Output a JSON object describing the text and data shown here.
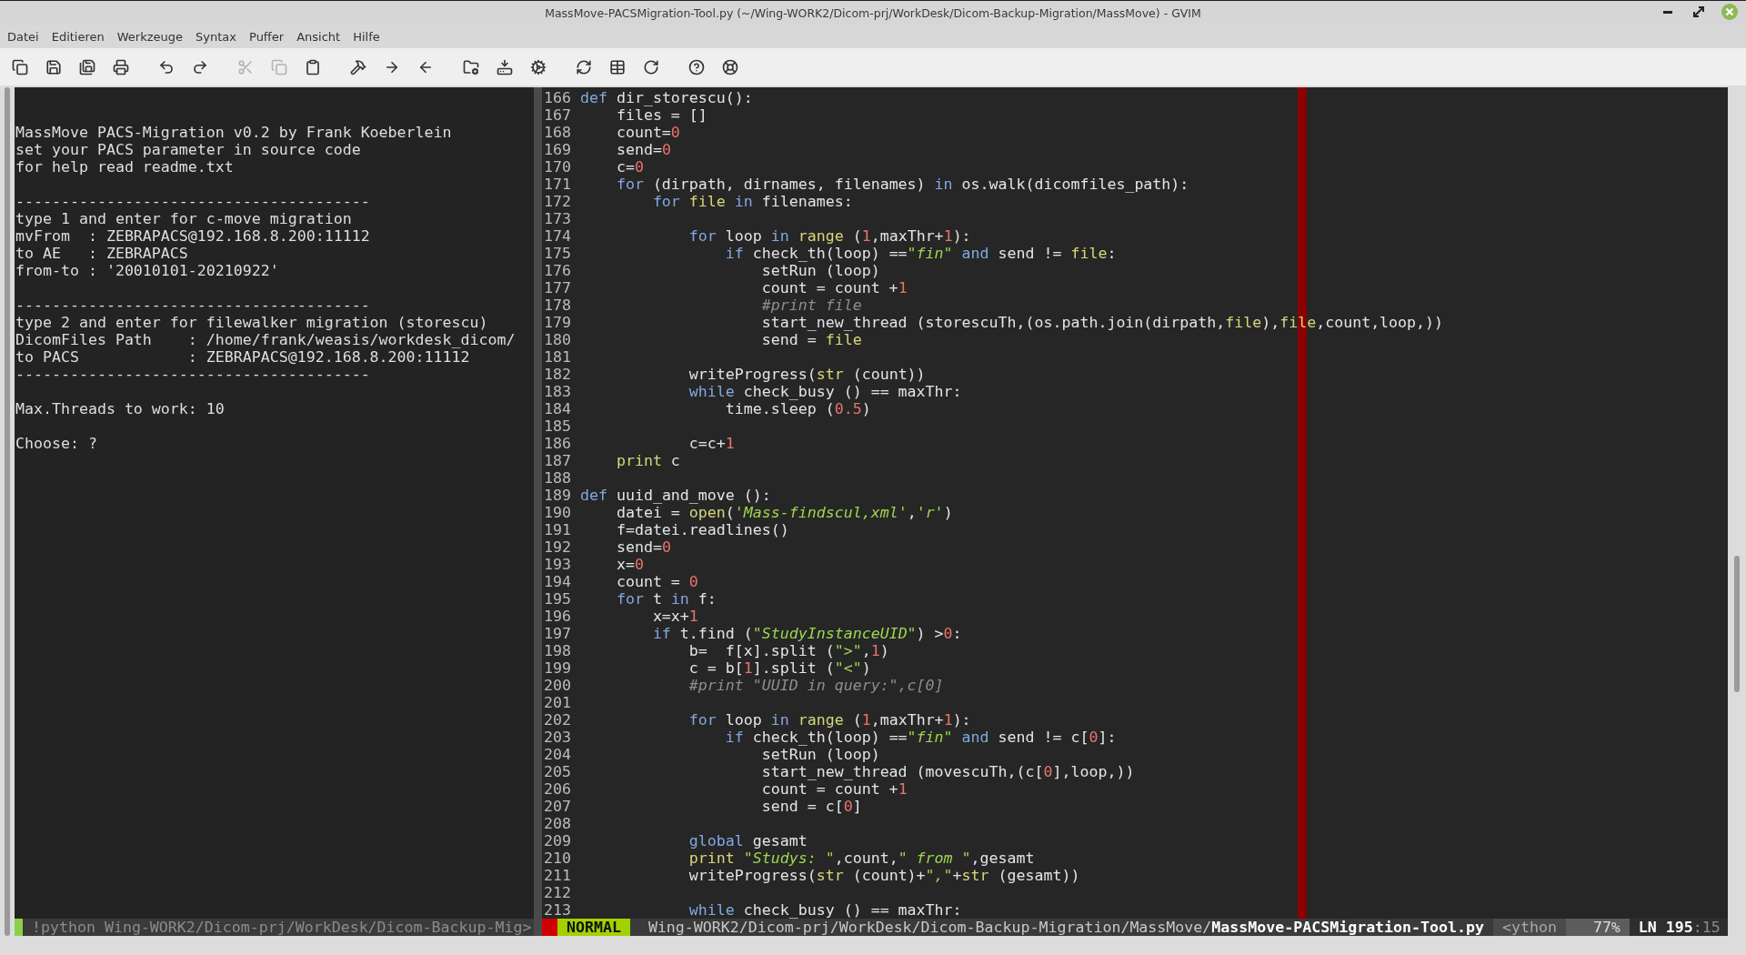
{
  "window": {
    "title": "MassMove-PACSMigration-Tool.py (~/Wing-WORK2/Dicom-prj/WorkDesk/Dicom-Backup-Migration/MassMove) - GVIM"
  },
  "menu": [
    "Datei",
    "Editieren",
    "Werkzeuge",
    "Syntax",
    "Puffer",
    "Ansicht",
    "Hilfe"
  ],
  "toolbar": {
    "groups": [
      [
        {
          "kind": "new-window",
          "disabled": false
        },
        {
          "kind": "save",
          "disabled": false
        },
        {
          "kind": "save-all",
          "disabled": false
        },
        {
          "kind": "print",
          "disabled": false
        }
      ],
      [
        {
          "kind": "undo",
          "disabled": false
        },
        {
          "kind": "redo",
          "disabled": false
        }
      ],
      [
        {
          "kind": "cut",
          "disabled": true
        },
        {
          "kind": "copy",
          "disabled": true
        },
        {
          "kind": "paste",
          "disabled": false
        }
      ],
      [
        {
          "kind": "replace",
          "disabled": false
        },
        {
          "kind": "find-next",
          "disabled": false
        },
        {
          "kind": "find-previous",
          "disabled": false
        }
      ],
      [
        {
          "kind": "load-session",
          "disabled": false
        },
        {
          "kind": "save-session",
          "disabled": false
        },
        {
          "kind": "run-script",
          "disabled": false
        }
      ],
      [
        {
          "kind": "make",
          "disabled": false
        },
        {
          "kind": "tags",
          "disabled": false
        },
        {
          "kind": "jump-tag",
          "disabled": false
        }
      ],
      [
        {
          "kind": "help",
          "disabled": false
        },
        {
          "kind": "find-help",
          "disabled": false
        }
      ]
    ]
  },
  "left_pane": {
    "groups": [
      [
        "MassMove PACS-Migration v0.2 by Frank Koeberlein",
        "set your PACS parameter in source code",
        "for help read readme.txt"
      ],
      [
        "---------------------------------------",
        "type 1 and enter for c-move migration",
        "mvFrom  : ZEBRAPACS@192.168.8.200:11112",
        "to AE   : ZEBRAPACS",
        "from-to : '20010101-20210922'"
      ],
      [
        "---------------------------------------",
        "type 2 and enter for filewalker migration (storescu)",
        "DicomFiles Path    : /home/frank/weasis/workdesk_dicom/",
        "to PACS            : ZEBRAPACS@192.168.8.200:11112",
        "---------------------------------------"
      ],
      [
        "Max.Threads to work: 10"
      ],
      [
        "Choose: ?"
      ]
    ],
    "status_line": "!python Wing-WORK2/Dicom-prj/WorkDesk/Dicom-Backup-Mig>"
  },
  "right_pane": {
    "code_lines": [
      {
        "number": "166",
        "tokens": [
          {
            "kind": "keyword",
            "text": "def"
          },
          {
            "kind": "plain",
            "text": " dir_storescu():"
          }
        ]
      },
      {
        "number": "167",
        "tokens": [
          {
            "kind": "plain",
            "text": "    files = []"
          }
        ]
      },
      {
        "number": "168",
        "tokens": [
          {
            "kind": "plain",
            "text": "    count="
          },
          {
            "kind": "number",
            "text": "0"
          }
        ]
      },
      {
        "number": "169",
        "tokens": [
          {
            "kind": "plain",
            "text": "    send="
          },
          {
            "kind": "number",
            "text": "0"
          }
        ]
      },
      {
        "number": "170",
        "tokens": [
          {
            "kind": "plain",
            "text": "    c="
          },
          {
            "kind": "number",
            "text": "0"
          }
        ]
      },
      {
        "number": "171",
        "tokens": [
          {
            "kind": "keyword",
            "text": "    for"
          },
          {
            "kind": "plain",
            "text": " (dirpath, dirnames, filenames) "
          },
          {
            "kind": "keyword",
            "text": "in"
          },
          {
            "kind": "plain",
            "text": " os.walk(dicomfiles_path):"
          }
        ]
      },
      {
        "number": "172",
        "tokens": [
          {
            "kind": "keyword",
            "text": "        for"
          },
          {
            "kind": "builtin",
            "text": " file"
          },
          {
            "kind": "keyword",
            "text": " in"
          },
          {
            "kind": "plain",
            "text": " filenames:"
          }
        ]
      },
      {
        "number": "173"
      },
      {
        "number": "174",
        "tokens": [
          {
            "kind": "keyword",
            "text": "            for"
          },
          {
            "kind": "plain",
            "text": " loop "
          },
          {
            "kind": "keyword",
            "text": "in"
          },
          {
            "kind": "builtin",
            "text": " range"
          },
          {
            "kind": "plain",
            "text": " ("
          },
          {
            "kind": "number",
            "text": "1"
          },
          {
            "kind": "plain",
            "text": ",maxThr+"
          },
          {
            "kind": "number",
            "text": "1"
          },
          {
            "kind": "plain",
            "text": "):"
          }
        ]
      },
      {
        "number": "175",
        "tokens": [
          {
            "kind": "keyword",
            "text": "                if"
          },
          {
            "kind": "plain",
            "text": " check_th(loop) =="
          },
          {
            "kind": "string",
            "text": "\"fin\""
          },
          {
            "kind": "keyword",
            "text": " and"
          },
          {
            "kind": "plain",
            "text": " send != "
          },
          {
            "kind": "builtin",
            "text": "file"
          },
          {
            "kind": "plain",
            "text": ":"
          }
        ]
      },
      {
        "number": "176",
        "tokens": [
          {
            "kind": "plain",
            "text": "                    setRun (loop)"
          }
        ]
      },
      {
        "number": "177",
        "tokens": [
          {
            "kind": "plain",
            "text": "                    count = count +"
          },
          {
            "kind": "number",
            "text": "1"
          }
        ]
      },
      {
        "number": "178",
        "tokens": [
          {
            "kind": "comment",
            "text": "                    #print file"
          }
        ]
      },
      {
        "number": "179",
        "tokens": [
          {
            "kind": "plain",
            "text": "                    start_new_thread (storescuTh,(os.path.join(dirpath,"
          },
          {
            "kind": "builtin",
            "text": "file"
          },
          {
            "kind": "plain",
            "text": "),"
          },
          {
            "kind": "builtin",
            "text": "file"
          },
          {
            "kind": "plain",
            "text": ",count,loop,))"
          }
        ]
      },
      {
        "number": "180",
        "tokens": [
          {
            "kind": "plain",
            "text": "                    send = "
          },
          {
            "kind": "builtin",
            "text": "file"
          }
        ]
      },
      {
        "number": "181"
      },
      {
        "number": "182",
        "tokens": [
          {
            "kind": "plain",
            "text": "            writeProgress("
          },
          {
            "kind": "builtin",
            "text": "str"
          },
          {
            "kind": "plain",
            "text": " (count))"
          }
        ]
      },
      {
        "number": "183",
        "tokens": [
          {
            "kind": "keyword",
            "text": "            while"
          },
          {
            "kind": "plain",
            "text": " check_busy () == maxThr:"
          }
        ]
      },
      {
        "number": "184",
        "tokens": [
          {
            "kind": "plain",
            "text": "                time.sleep ("
          },
          {
            "kind": "number",
            "text": "0.5"
          },
          {
            "kind": "plain",
            "text": ")"
          }
        ]
      },
      {
        "number": "185"
      },
      {
        "number": "186",
        "tokens": [
          {
            "kind": "plain",
            "text": "            c=c+"
          },
          {
            "kind": "number",
            "text": "1"
          }
        ]
      },
      {
        "number": "187",
        "tokens": [
          {
            "kind": "builtin",
            "text": "    print"
          },
          {
            "kind": "plain",
            "text": " c"
          }
        ]
      },
      {
        "number": "188"
      },
      {
        "number": "189",
        "tokens": [
          {
            "kind": "keyword",
            "text": "def"
          },
          {
            "kind": "plain",
            "text": " uuid_and_move ():"
          }
        ]
      },
      {
        "number": "190",
        "tokens": [
          {
            "kind": "plain",
            "text": "    datei = "
          },
          {
            "kind": "builtin",
            "text": "open"
          },
          {
            "kind": "plain",
            "text": "("
          },
          {
            "kind": "string",
            "text": "'Mass-findscul,xml'"
          },
          {
            "kind": "plain",
            "text": ","
          },
          {
            "kind": "string",
            "text": "'r'"
          },
          {
            "kind": "plain",
            "text": ")"
          }
        ]
      },
      {
        "number": "191",
        "tokens": [
          {
            "kind": "plain",
            "text": "    f=datei.readlines()"
          }
        ]
      },
      {
        "number": "192",
        "tokens": [
          {
            "kind": "plain",
            "text": "    send="
          },
          {
            "kind": "number",
            "text": "0"
          }
        ]
      },
      {
        "number": "193",
        "tokens": [
          {
            "kind": "plain",
            "text": "    x="
          },
          {
            "kind": "number",
            "text": "0"
          }
        ]
      },
      {
        "number": "194",
        "tokens": [
          {
            "kind": "plain",
            "text": "    count = "
          },
          {
            "kind": "number",
            "text": "0"
          }
        ]
      },
      {
        "number": "195",
        "tokens": [
          {
            "kind": "keyword",
            "text": "    for"
          },
          {
            "kind": "plain",
            "text": " t "
          },
          {
            "kind": "keyword",
            "text": "in"
          },
          {
            "kind": "plain",
            "text": " f:"
          }
        ]
      },
      {
        "number": "196",
        "tokens": [
          {
            "kind": "plain",
            "text": "        x=x+"
          },
          {
            "kind": "number",
            "text": "1"
          }
        ]
      },
      {
        "number": "197",
        "tokens": [
          {
            "kind": "keyword",
            "text": "        if"
          },
          {
            "kind": "plain",
            "text": " t.find ("
          },
          {
            "kind": "string",
            "text": "\"StudyInstanceUID\""
          },
          {
            "kind": "plain",
            "text": ") >"
          },
          {
            "kind": "number",
            "text": "0"
          },
          {
            "kind": "plain",
            "text": ":"
          }
        ]
      },
      {
        "number": "198",
        "tokens": [
          {
            "kind": "plain",
            "text": "            b=  f[x].split ("
          },
          {
            "kind": "string",
            "text": "\">\""
          },
          {
            "kind": "plain",
            "text": ","
          },
          {
            "kind": "number",
            "text": "1"
          },
          {
            "kind": "plain",
            "text": ")"
          }
        ]
      },
      {
        "number": "199",
        "tokens": [
          {
            "kind": "plain",
            "text": "            c = b["
          },
          {
            "kind": "number",
            "text": "1"
          },
          {
            "kind": "plain",
            "text": "].split ("
          },
          {
            "kind": "string",
            "text": "\"<\""
          },
          {
            "kind": "plain",
            "text": ")"
          }
        ]
      },
      {
        "number": "200",
        "tokens": [
          {
            "kind": "comment",
            "text": "            #print \"UUID in query:\",c[0]"
          }
        ]
      },
      {
        "number": "201"
      },
      {
        "number": "202",
        "tokens": [
          {
            "kind": "keyword",
            "text": "            for"
          },
          {
            "kind": "plain",
            "text": " loop "
          },
          {
            "kind": "keyword",
            "text": "in"
          },
          {
            "kind": "builtin",
            "text": " range"
          },
          {
            "kind": "plain",
            "text": " ("
          },
          {
            "kind": "number",
            "text": "1"
          },
          {
            "kind": "plain",
            "text": ",maxThr+"
          },
          {
            "kind": "number",
            "text": "1"
          },
          {
            "kind": "plain",
            "text": "):"
          }
        ]
      },
      {
        "number": "203",
        "tokens": [
          {
            "kind": "keyword",
            "text": "                if"
          },
          {
            "kind": "plain",
            "text": " check_th(loop) =="
          },
          {
            "kind": "string",
            "text": "\"fin\""
          },
          {
            "kind": "keyword",
            "text": " and"
          },
          {
            "kind": "plain",
            "text": " send != c["
          },
          {
            "kind": "number",
            "text": "0"
          },
          {
            "kind": "plain",
            "text": "]:"
          }
        ]
      },
      {
        "number": "204",
        "tokens": [
          {
            "kind": "plain",
            "text": "                    setRun (loop)"
          }
        ]
      },
      {
        "number": "205",
        "tokens": [
          {
            "kind": "plain",
            "text": "                    start_new_thread (movescuTh,(c["
          },
          {
            "kind": "number",
            "text": "0"
          },
          {
            "kind": "plain",
            "text": "],loop,))"
          }
        ]
      },
      {
        "number": "206",
        "tokens": [
          {
            "kind": "plain",
            "text": "                    count = count +"
          },
          {
            "kind": "number",
            "text": "1"
          }
        ]
      },
      {
        "number": "207",
        "tokens": [
          {
            "kind": "plain",
            "text": "                    send = c["
          },
          {
            "kind": "number",
            "text": "0"
          },
          {
            "kind": "plain",
            "text": "]"
          }
        ]
      },
      {
        "number": "208"
      },
      {
        "number": "209",
        "tokens": [
          {
            "kind": "keyword",
            "text": "            global"
          },
          {
            "kind": "plain",
            "text": " gesamt"
          }
        ]
      },
      {
        "number": "210",
        "tokens": [
          {
            "kind": "builtin",
            "text": "            print"
          },
          {
            "kind": "string",
            "text": " \"Studys: \""
          },
          {
            "kind": "plain",
            "text": ",count,"
          },
          {
            "kind": "string",
            "text": "\" from \""
          },
          {
            "kind": "plain",
            "text": ",gesamt"
          }
        ]
      },
      {
        "number": "211",
        "tokens": [
          {
            "kind": "plain",
            "text": "            writeProgress("
          },
          {
            "kind": "builtin",
            "text": "str"
          },
          {
            "kind": "plain",
            "text": " (count)+"
          },
          {
            "kind": "string",
            "text": "\",\""
          },
          {
            "kind": "plain",
            "text": "+"
          },
          {
            "kind": "builtin",
            "text": "str"
          },
          {
            "kind": "plain",
            "text": " (gesamt))"
          }
        ]
      },
      {
        "number": "212"
      },
      {
        "number": "213",
        "tokens": [
          {
            "kind": "keyword",
            "text": "            while"
          },
          {
            "kind": "plain",
            "text": " check_busy () == maxThr:"
          }
        ]
      }
    ],
    "status_line": {
      "mode": "NORMAL",
      "path": "Wing-WORK2/Dicom-prj/WorkDesk/Dicom-Backup-Migration/MassMove/**MassMove-PACSMigration-Tool.py**",
      "filetype": "<ython",
      "percent": "77%",
      "position": "**LN 195**:15"
    }
  }
}
